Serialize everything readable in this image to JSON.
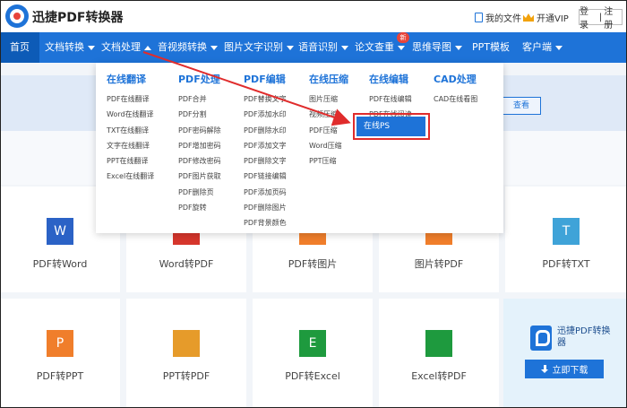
{
  "header": {
    "brand": "迅捷PDF转换器",
    "my_files": "我的文件",
    "vip": "开通VIP",
    "login": "登录",
    "separator": "|",
    "register": "注册"
  },
  "nav": {
    "items": [
      {
        "label": "首页"
      },
      {
        "label": "文档转换"
      },
      {
        "label": "文档处理"
      },
      {
        "label": "音视频转换"
      },
      {
        "label": "图片文字识别"
      },
      {
        "label": "语音识别"
      },
      {
        "label": "论文查重"
      },
      {
        "label": "思维导图"
      },
      {
        "label": "PPT模板"
      },
      {
        "label": "客户端"
      }
    ],
    "badge": "新"
  },
  "banner": {
    "button": "查看"
  },
  "menu": {
    "columns": [
      {
        "title": "在线翻译",
        "items": [
          "PDF在线翻译",
          "Word在线翻译",
          "TXT在线翻译",
          "文字在线翻译",
          "PPT在线翻译",
          "Excel在线翻译"
        ]
      },
      {
        "title": "PDF处理",
        "items": [
          "PDF合并",
          "PDF分割",
          "PDF密码解除",
          "PDF增加密码",
          "PDF修改密码",
          "PDF图片获取",
          "PDF删除页",
          "PDF旋转"
        ]
      },
      {
        "title": "PDF编辑",
        "items": [
          "PDF替换文字",
          "PDF添加水印",
          "PDF删除水印",
          "PDF添加文字",
          "PDF删除文字",
          "PDF链接编辑",
          "PDF添加页码",
          "PDF删除图片",
          "PDF背景颜色"
        ]
      },
      {
        "title": "在线压缩",
        "items": [
          "图片压缩",
          "视频压缩",
          "PDF压缩",
          "Word压缩",
          "PPT压缩"
        ]
      },
      {
        "title": "在线编辑",
        "items": [
          "PDF在线编辑",
          "PDF在线阅读"
        ]
      },
      {
        "title": "CAD处理",
        "items": [
          "CAD在线看图"
        ]
      }
    ],
    "highlighted": "在线PS"
  },
  "tools": [
    {
      "label": "PDF转Word",
      "icon": "W",
      "color": "#2b62c6"
    },
    {
      "label": "Word转PDF",
      "icon": "",
      "color": "#d6362c"
    },
    {
      "label": "PDF转图片",
      "icon": "",
      "color": "#f07e2b"
    },
    {
      "label": "图片转PDF",
      "icon": "",
      "color": "#f07e2b"
    },
    {
      "label": "PDF转TXT",
      "icon": "T",
      "color": "#3fa3d8"
    },
    {
      "label": "PDF转PPT",
      "icon": "P",
      "color": "#f07e2b"
    },
    {
      "label": "PPT转PDF",
      "icon": "",
      "color": "#e69b2a"
    },
    {
      "label": "PDF转Excel",
      "icon": "E",
      "color": "#1e9a3e"
    },
    {
      "label": "Excel转PDF",
      "icon": "",
      "color": "#1e9a3e"
    }
  ],
  "promo": {
    "name": "迅捷PDF转换器",
    "download": "立即下载"
  },
  "colors": {
    "accent": "#1e73d8",
    "highlight_border": "#e02c2c"
  }
}
